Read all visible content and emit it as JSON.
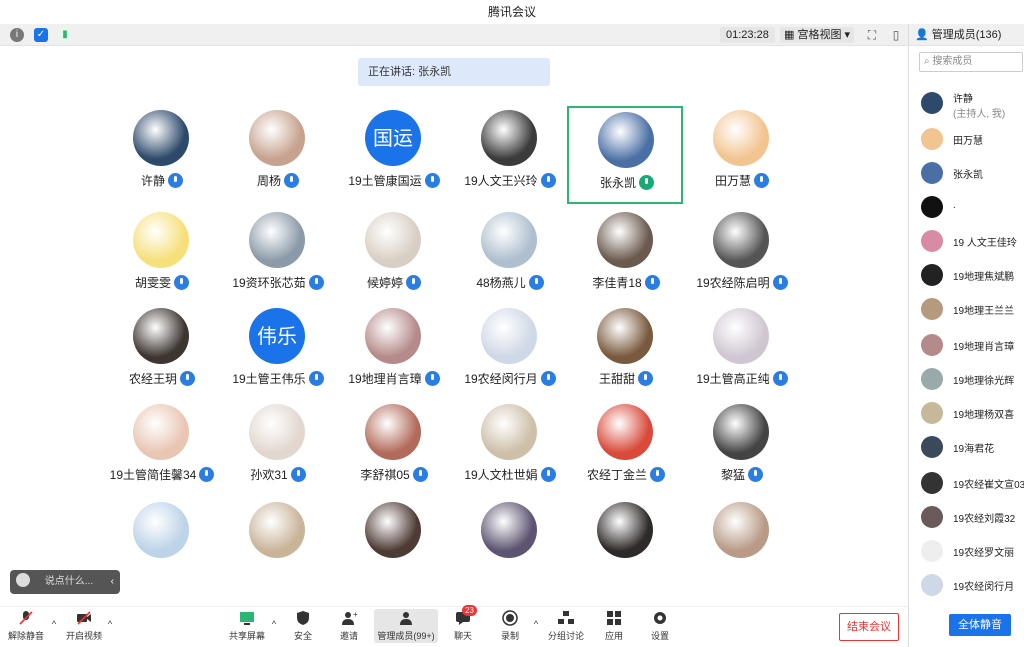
{
  "window": {
    "title": "腾讯会议"
  },
  "statusbar": {
    "timer": "01:23:28",
    "view_mode": "宫格视图"
  },
  "speaking": {
    "label": "正在讲话: 张永凯"
  },
  "participants": [
    {
      "name": "许静",
      "avatar": "photo",
      "color": "#2d4a6b"
    },
    {
      "name": "周杨",
      "avatar": "photo",
      "color": "#c7a28e"
    },
    {
      "name": "19土管康国运",
      "avatar": "text",
      "initials": "国运"
    },
    {
      "name": "19人文王兴玲",
      "avatar": "photo",
      "color": "#3b3b3b"
    },
    {
      "name": "张永凯",
      "avatar": "photo",
      "color": "#4a6fa5",
      "active": true
    },
    {
      "name": "田万慧",
      "avatar": "photo",
      "color": "#f2c48f"
    },
    {
      "name": "胡雯雯",
      "avatar": "photo",
      "color": "#f6e07a"
    },
    {
      "name": "19资环张芯茹",
      "avatar": "photo",
      "color": "#8b9aa8"
    },
    {
      "name": "候婷婷",
      "avatar": "photo",
      "color": "#d8cfc4"
    },
    {
      "name": "48杨燕儿",
      "avatar": "photo",
      "color": "#aebfcf"
    },
    {
      "name": "李佳青18",
      "avatar": "photo",
      "color": "#6b5a4e"
    },
    {
      "name": "19农经陈启明",
      "avatar": "photo",
      "color": "#555"
    },
    {
      "name": "农经王玥",
      "avatar": "photo",
      "color": "#3d3530"
    },
    {
      "name": "19土管王伟乐",
      "avatar": "text",
      "initials": "伟乐"
    },
    {
      "name": "19地理肖言璋",
      "avatar": "photo",
      "color": "#b58a8a"
    },
    {
      "name": "19农经闵行月",
      "avatar": "photo",
      "color": "#cfd8e6"
    },
    {
      "name": "王甜甜",
      "avatar": "photo",
      "color": "#7a5a3e"
    },
    {
      "name": "19土管高正纯",
      "avatar": "photo",
      "color": "#cfc6d2"
    },
    {
      "name": "19土管简佳馨34",
      "avatar": "photo",
      "color": "#e9c5b3"
    },
    {
      "name": "孙欢31",
      "avatar": "photo",
      "color": "#e2d7cf"
    },
    {
      "name": "李舒祺05",
      "avatar": "photo",
      "color": "#b26b5a"
    },
    {
      "name": "19人文杜世娟",
      "avatar": "photo",
      "color": "#cdbfa8"
    },
    {
      "name": "农经丁金兰",
      "avatar": "photo",
      "color": "#d94a3a"
    },
    {
      "name": "黎猛",
      "avatar": "photo",
      "color": "#444"
    },
    {
      "name": "",
      "avatar": "photo",
      "color": "#bcd3e8"
    },
    {
      "name": "",
      "avatar": "photo",
      "color": "#c9b49a"
    },
    {
      "name": "",
      "avatar": "photo",
      "color": "#4e3b35"
    },
    {
      "name": "",
      "avatar": "photo",
      "color": "#5c5470"
    },
    {
      "name": "",
      "avatar": "photo",
      "color": "#2f2a2a"
    },
    {
      "name": "",
      "avatar": "photo",
      "color": "#b89a86"
    }
  ],
  "chat": {
    "placeholder": "说点什么..."
  },
  "sidebar": {
    "header": "管理成员(136)",
    "search_placeholder": "搜索成员",
    "members": [
      {
        "name": "许静",
        "sub": "(主持人, 我)",
        "color": "#2d4a6b"
      },
      {
        "name": "田万慧",
        "color": "#f2c48f"
      },
      {
        "name": "张永凯",
        "color": "#4a6fa5"
      },
      {
        "name": ".",
        "color": "#111"
      },
      {
        "name": "19 人文王佳玲",
        "color": "#d98ba6"
      },
      {
        "name": "19地理焦斌鹏",
        "color": "#222"
      },
      {
        "name": "19地理王兰兰",
        "color": "#b59a7e"
      },
      {
        "name": "19地理肖言璋",
        "color": "#b58a8a"
      },
      {
        "name": "19地理徐光辉",
        "color": "#9aa"
      },
      {
        "name": "19地理杨双喜",
        "color": "#c8b89a"
      },
      {
        "name": "19海君花",
        "color": "#3a4a5a"
      },
      {
        "name": "19农经崔文宣03",
        "color": "#333"
      },
      {
        "name": "19农经刘霞32",
        "color": "#6a5a5a"
      },
      {
        "name": "19农经罗文丽",
        "color": "#eee"
      },
      {
        "name": "19农经闵行月",
        "color": "#cfd8e6"
      }
    ],
    "mute_all": "全体静音"
  },
  "toolbar": {
    "unmute": "解除静音",
    "start_video": "开启视频",
    "share_screen": "共享屏幕",
    "security": "安全",
    "invite": "邀请",
    "manage": "管理成员(99+)",
    "chat": "聊天",
    "chat_badge": "23",
    "record": "录制",
    "breakout": "分组讨论",
    "apps": "应用",
    "settings": "设置",
    "end": "结束会议"
  }
}
